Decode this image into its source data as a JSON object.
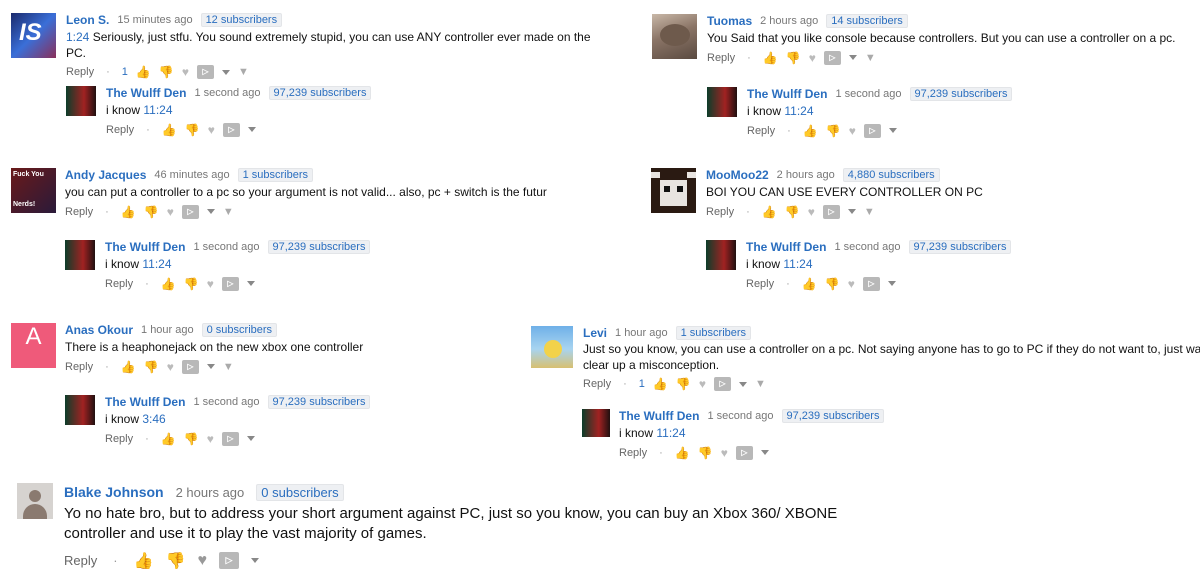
{
  "labels": {
    "reply": "Reply",
    "dot": "·"
  },
  "icons": {
    "thumbs_up": "thumbs-up-icon",
    "thumbs_down": "thumbs-down-icon",
    "heart": "heart-icon",
    "share": "share-icon",
    "pin": "pin-icon",
    "caret": "caret-down-icon"
  },
  "colors": {
    "link": "#2a6ebf",
    "badge_bg": "#eef0f3"
  },
  "comments": {
    "leon": {
      "author": "Leon S.",
      "time": "15 minutes ago",
      "subs": "12 subscribers",
      "ts": "1:24",
      "text": " Seriously, just stfu. You sound extremely stupid, you can use ANY controller ever made on the PC.",
      "likes": "1"
    },
    "leon_reply": {
      "author": "The Wulff Den",
      "time": "1 second ago",
      "subs": "97,239 subscribers",
      "pre": "i know ",
      "ts": "11:24"
    },
    "tuomas": {
      "author": "Tuomas",
      "time": "2 hours ago",
      "subs": "14 subscribers",
      "text": "You Said that you like console because controllers. But you can use a controller on a pc."
    },
    "tuomas_reply": {
      "author": "The Wulff Den",
      "time": "1 second ago",
      "subs": "97,239 subscribers",
      "pre": "i know ",
      "ts": "11:24"
    },
    "andy": {
      "author": "Andy Jacques",
      "time": "46 minutes ago",
      "subs": "1 subscribers",
      "text": "you can put a controller to a pc so your argument is not valid... also, pc + switch is the futur",
      "avatar_text1": "Fuck You",
      "avatar_text2": "Nerds!"
    },
    "andy_reply": {
      "author": "The Wulff Den",
      "time": "1 second ago",
      "subs": "97,239 subscribers",
      "pre": "i know ",
      "ts": "11:24"
    },
    "moomoo": {
      "author": "MooMoo22",
      "time": "2 hours ago",
      "subs": "4,880 subscribers",
      "text": "BOI YOU CAN USE EVERY CONTROLLER ON PC"
    },
    "moomoo_reply": {
      "author": "The Wulff Den",
      "time": "1 second ago",
      "subs": "97,239 subscribers",
      "pre": "i know ",
      "ts": "11:24"
    },
    "anas": {
      "author": "Anas Okour",
      "time": "1 hour ago",
      "subs": "0 subscribers",
      "text": "There is a heaphonejack on the new xbox one controller",
      "avatar_letter": "A"
    },
    "anas_reply": {
      "author": "The Wulff Den",
      "time": "1 second ago",
      "subs": "97,239 subscribers",
      "pre": "i know ",
      "ts": "3:46"
    },
    "levi": {
      "author": "Levi",
      "time": "1 hour ago",
      "subs": "1 subscribers",
      "text1": "Just so you know, you can use a controller on a pc. Not saying anyone has to go to PC if they do not want to, just want to",
      "text2": "clear up a misconception.",
      "likes": "1"
    },
    "levi_reply": {
      "author": "The Wulff Den",
      "time": "1 second ago",
      "subs": "97,239 subscribers",
      "pre": "i know ",
      "ts": "11:24"
    },
    "blake": {
      "author": "Blake Johnson",
      "time": "2 hours ago",
      "subs": "0 subscribers",
      "text1": "Yo no hate bro, but to address your short argument against PC, just so you know, you can buy an Xbox 360/ XBONE",
      "text2": "controller and use it to play the vast majority of games."
    }
  }
}
